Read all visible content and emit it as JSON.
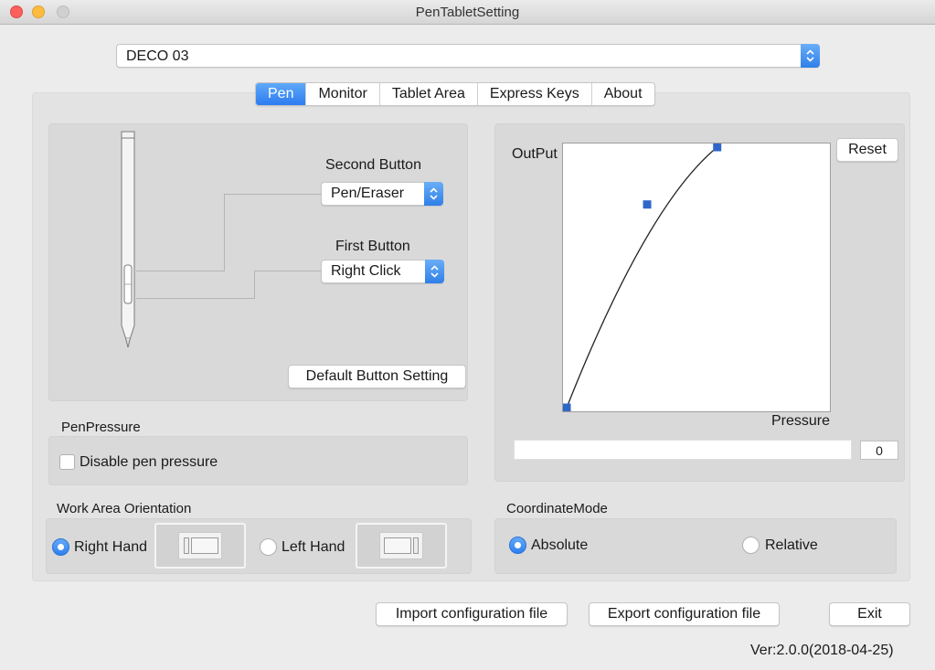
{
  "window": {
    "title": "PenTabletSetting"
  },
  "device": {
    "selected": "DECO 03"
  },
  "tabs": [
    {
      "label": "Pen",
      "active": true
    },
    {
      "label": "Monitor",
      "active": false
    },
    {
      "label": "Tablet Area",
      "active": false
    },
    {
      "label": "Express Keys",
      "active": false
    },
    {
      "label": "About",
      "active": false
    }
  ],
  "pen": {
    "second_button": {
      "label": "Second Button",
      "value": "Pen/Eraser"
    },
    "first_button": {
      "label": "First Button",
      "value": "Right Click"
    },
    "default_button_label": "Default  Button Setting"
  },
  "pressure": {
    "group_label": "PenPressure",
    "disable_label": "Disable pen pressure",
    "disabled": false,
    "output_label": "OutPut",
    "pressure_label": "Pressure",
    "reset_label": "Reset",
    "value": "0",
    "curve_points": [
      [
        0,
        0
      ],
      [
        0.31,
        0.78
      ],
      [
        0.58,
        1.0
      ]
    ]
  },
  "orientation": {
    "group_label": "Work Area Orientation",
    "right_label": "Right Hand",
    "left_label": "Left Hand",
    "selected": "right"
  },
  "coordinate": {
    "group_label": "CoordinateMode",
    "absolute_label": "Absolute",
    "relative_label": "Relative",
    "selected": "absolute"
  },
  "footer": {
    "import_label": "Import configuration file",
    "export_label": "Export configuration file",
    "exit_label": "Exit",
    "version": "Ver:2.0.0(2018-04-25)"
  },
  "colors": {
    "accent": "#2f7ff0",
    "curve_handle": "#2f67c9"
  }
}
